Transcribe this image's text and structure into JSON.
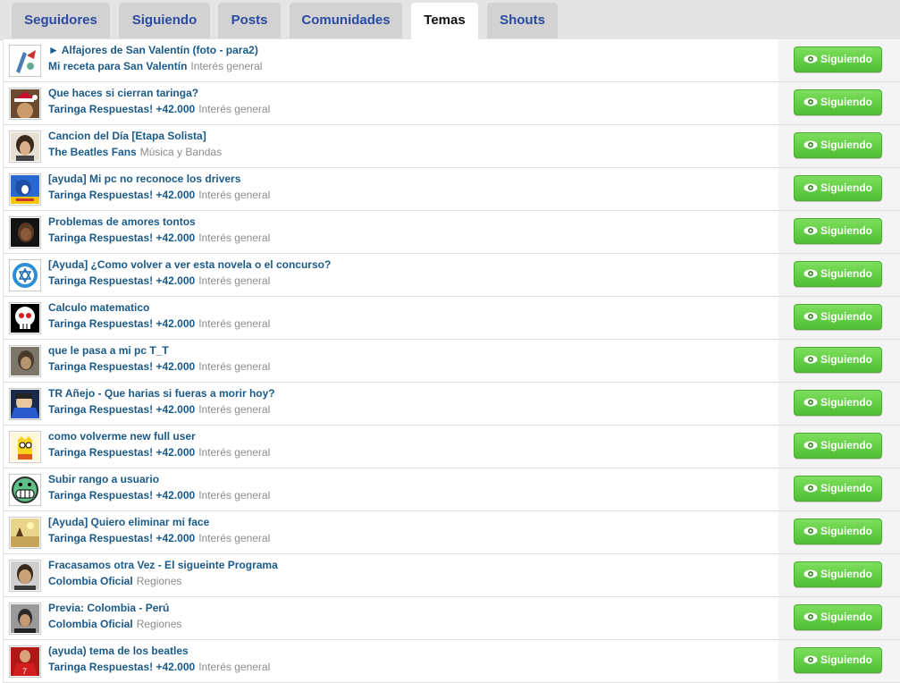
{
  "tabs": [
    {
      "label": "Seguidores"
    },
    {
      "label": "Siguiendo"
    },
    {
      "label": "Posts"
    },
    {
      "label": "Comunidades"
    },
    {
      "label": "Temas"
    },
    {
      "label": "Shouts"
    }
  ],
  "active_tab": "Temas",
  "follow_button_label": "Siguiendo",
  "rows": [
    {
      "title": "► Alfajores de San Valentín (foto - para2)",
      "community": "Mi receta para San Valentín",
      "category": "Interés general",
      "avatar": "pencil-figure-avatar"
    },
    {
      "title": "Que haces si cierran taringa?",
      "community": "Taringa Respuestas! +42.000",
      "category": "Interés general",
      "avatar": "santa-hat-avatar"
    },
    {
      "title": "Cancion del Día [Etapa Solista]",
      "community": "The Beatles Fans",
      "category": "Música y Bandas",
      "avatar": "beatle-photo-avatar"
    },
    {
      "title": "[ayuda] Mi pc no reconoce los drivers",
      "community": "Taringa Respuestas! +42.000",
      "category": "Interés general",
      "avatar": "cartoon-hedgehog-avatar"
    },
    {
      "title": "Problemas de amores tontos",
      "community": "Taringa Respuestas! +42.000",
      "category": "Interés general",
      "avatar": "dark-portrait-avatar"
    },
    {
      "title": "[Ayuda] ¿Como volver a ver esta novela o el concurso?",
      "community": "Taringa Respuestas! +42.000",
      "category": "Interés general",
      "avatar": "blue-star-flag-avatar"
    },
    {
      "title": "Calculo matematico",
      "community": "Taringa Respuestas! +42.000",
      "category": "Interés general",
      "avatar": "skull-avatar"
    },
    {
      "title": "que le pasa a mi pc T_T",
      "community": "Taringa Respuestas! +42.000",
      "category": "Interés general",
      "avatar": "face-photo-avatar"
    },
    {
      "title": "TR Añejo - Que harias si fueras a morir hoy?",
      "community": "Taringa Respuestas! +42.000",
      "category": "Interés general",
      "avatar": "blue-character-avatar"
    },
    {
      "title": "como volverme new full user",
      "community": "Taringa Respuestas! +42.000",
      "category": "Interés general",
      "avatar": "yellow-cartoon-avatar"
    },
    {
      "title": "Subir rango a usuario",
      "community": "Taringa Respuestas! +42.000",
      "category": "Interés general",
      "avatar": "grinning-face-avatar"
    },
    {
      "title": "[Ayuda] Quiero eliminar mi face",
      "community": "Taringa Respuestas! +42.000",
      "category": "Interés general",
      "avatar": "desert-scene-avatar"
    },
    {
      "title": "Fracasamos otra Vez - El sigueinte Programa",
      "community": "Colombia Oficial",
      "category": "Regiones",
      "avatar": "man-portrait-avatar"
    },
    {
      "title": "Previa: Colombia - Perú",
      "community": "Colombia Oficial",
      "category": "Regiones",
      "avatar": "young-man-portrait-avatar"
    },
    {
      "title": "(ayuda) tema de los beatles",
      "community": "Taringa Respuestas! +42.000",
      "category": "Interés general",
      "avatar": "red-jersey-avatar"
    }
  ]
}
